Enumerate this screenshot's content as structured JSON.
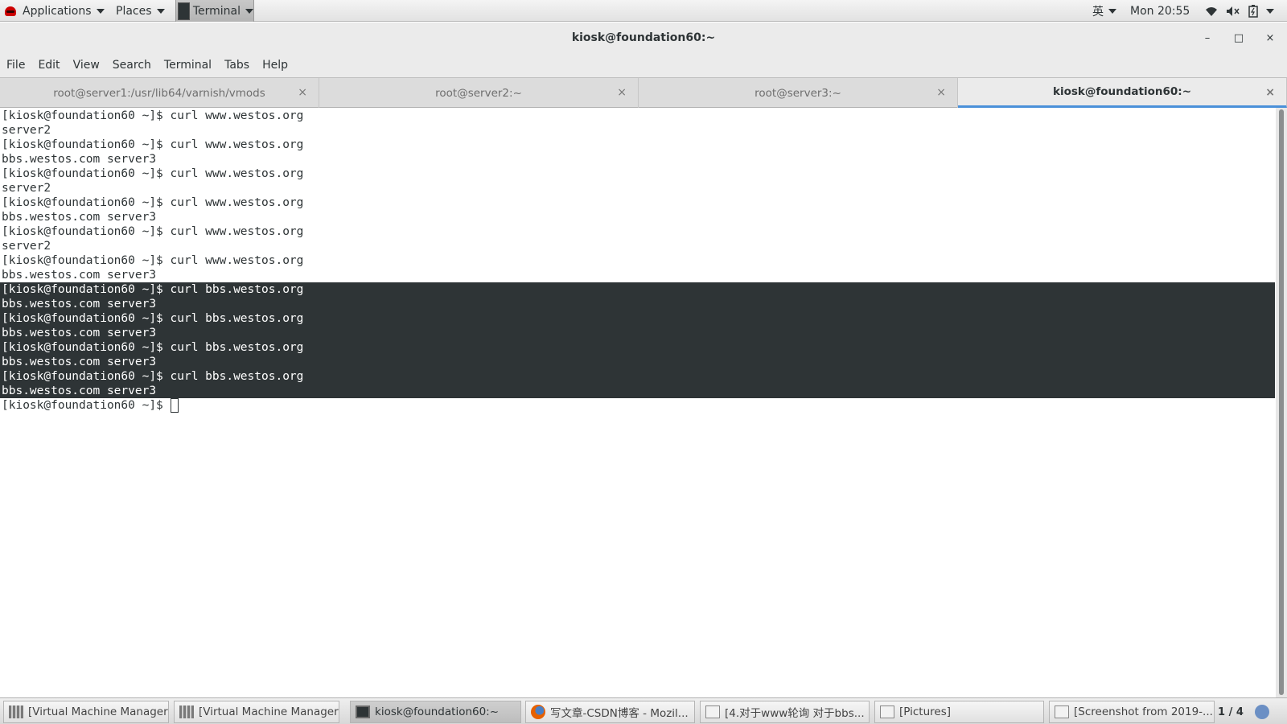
{
  "topbar": {
    "applications": "Applications",
    "places": "Places",
    "terminal": "Terminal",
    "input_method": "英",
    "clock": "Mon 20:55"
  },
  "window": {
    "title": "kiosk@foundation60:~",
    "minimize": "–",
    "maximize": "□",
    "close": "×"
  },
  "menubar": {
    "items": [
      "File",
      "Edit",
      "View",
      "Search",
      "Terminal",
      "Tabs",
      "Help"
    ]
  },
  "tabs": [
    {
      "label": "root@server1:/usr/lib64/varnish/vmods",
      "active": false
    },
    {
      "label": "root@server2:~",
      "active": false
    },
    {
      "label": "root@server3:~",
      "active": false
    },
    {
      "label": "kiosk@foundation60:~",
      "active": true
    }
  ],
  "tab_close": "×",
  "terminal": {
    "lines": [
      "[kiosk@foundation60 ~]$ curl www.westos.org",
      "server2",
      "[kiosk@foundation60 ~]$ curl www.westos.org",
      "bbs.westos.com server3",
      "[kiosk@foundation60 ~]$ curl www.westos.org",
      "server2",
      "[kiosk@foundation60 ~]$ curl www.westos.org",
      "bbs.westos.com server3",
      "[kiosk@foundation60 ~]$ curl www.westos.org",
      "server2",
      "[kiosk@foundation60 ~]$ curl www.westos.org",
      "bbs.westos.com server3",
      "[kiosk@foundation60 ~]$ curl bbs.westos.org",
      "bbs.westos.com server3",
      "[kiosk@foundation60 ~]$ curl bbs.westos.org",
      "bbs.westos.com server3",
      "[kiosk@foundation60 ~]$ curl bbs.westos.org",
      "bbs.westos.com server3",
      "[kiosk@foundation60 ~]$ curl bbs.westos.org",
      "bbs.westos.com server3"
    ],
    "prompt": "[kiosk@foundation60 ~]$ "
  },
  "taskbar": {
    "items": [
      {
        "label": "[Virtual Machine Manager]",
        "icon": "vm-icon"
      },
      {
        "label": "[Virtual Machine Manager]",
        "icon": "vm-icon"
      },
      {
        "label": "kiosk@foundation60:~",
        "icon": "terminal-icon"
      },
      {
        "label": "写文章-CSDN博客 - Mozil...",
        "icon": "firefox-icon"
      },
      {
        "label": "[4.对于www轮询 对于bbs...",
        "icon": "document-icon"
      },
      {
        "label": "[Pictures]",
        "icon": "folder-icon"
      },
      {
        "label": "[Screenshot from 2019-...",
        "icon": "image-viewer-icon"
      }
    ],
    "pager": "1 / 4"
  },
  "colors": {
    "selection_bg": "#2e3436",
    "active_tab_underline": "#4a90d9"
  }
}
